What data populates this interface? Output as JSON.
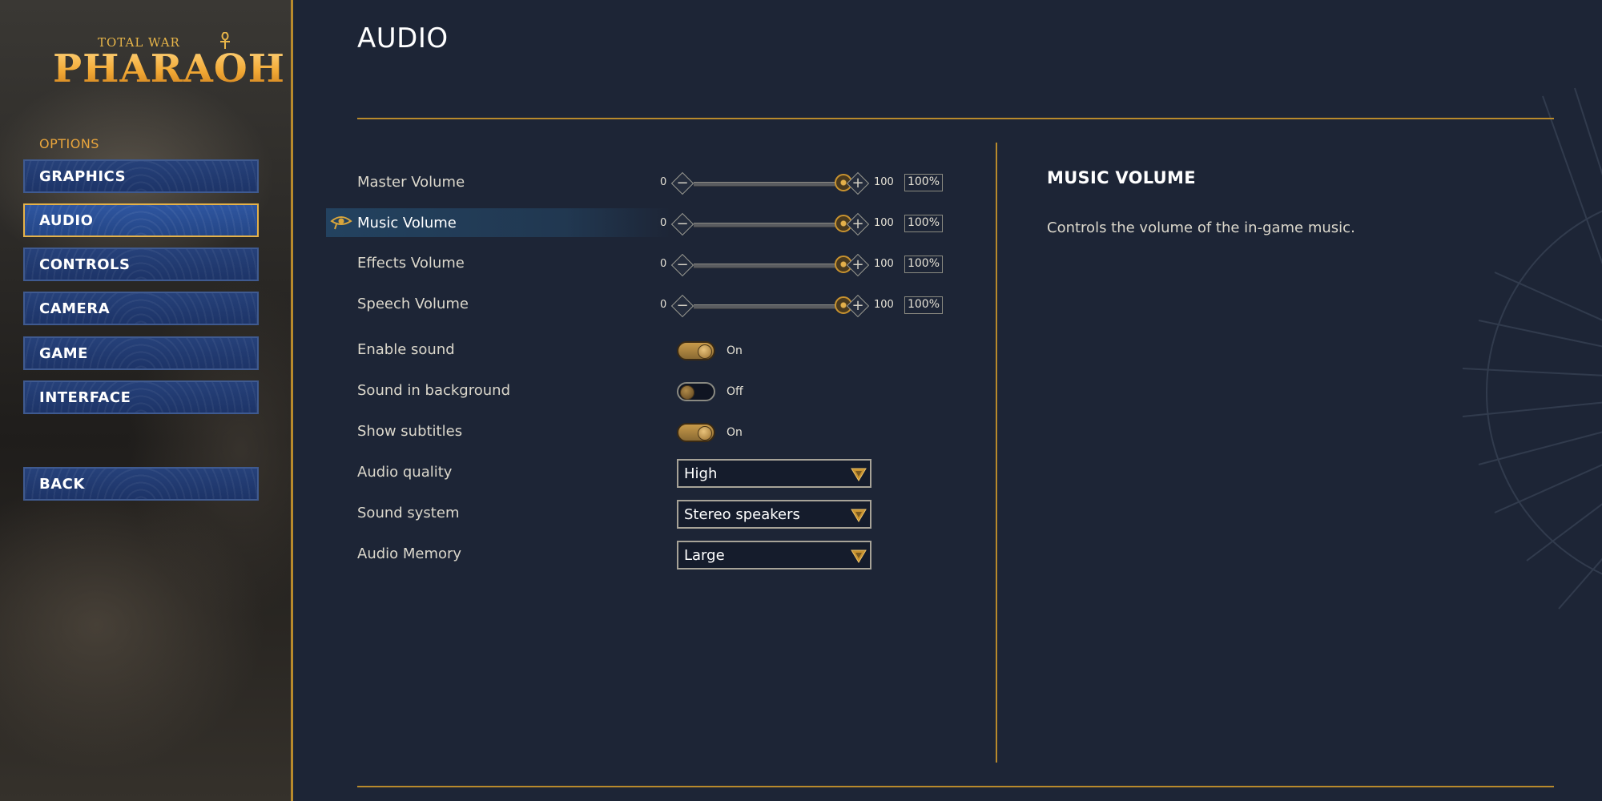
{
  "logo": {
    "subtitle": "TOTAL WAR",
    "title": "PHARAOH"
  },
  "sidebar": {
    "section_label": "OPTIONS",
    "items": [
      {
        "label": "GRAPHICS",
        "active": false
      },
      {
        "label": "AUDIO",
        "active": true
      },
      {
        "label": "CONTROLS",
        "active": false
      },
      {
        "label": "CAMERA",
        "active": false
      },
      {
        "label": "GAME",
        "active": false
      },
      {
        "label": "INTERFACE",
        "active": false
      }
    ],
    "back_label": "BACK"
  },
  "page": {
    "title": "AUDIO"
  },
  "volumes": [
    {
      "label": "Master Volume",
      "min": "0",
      "max": "100",
      "value": 100,
      "percent": "100%"
    },
    {
      "label": "Music Volume",
      "min": "0",
      "max": "100",
      "value": 100,
      "percent": "100%",
      "highlighted": true
    },
    {
      "label": "Effects Volume",
      "min": "0",
      "max": "100",
      "value": 100,
      "percent": "100%"
    },
    {
      "label": "Speech Volume",
      "min": "0",
      "max": "100",
      "value": 100,
      "percent": "100%"
    }
  ],
  "toggles": [
    {
      "label": "Enable sound",
      "state": "On",
      "on": true
    },
    {
      "label": "Sound in background",
      "state": "Off",
      "on": false
    },
    {
      "label": "Show subtitles",
      "state": "On",
      "on": true
    }
  ],
  "dropdowns": [
    {
      "label": "Audio quality",
      "value": "High"
    },
    {
      "label": "Sound system",
      "value": "Stereo speakers"
    },
    {
      "label": "Audio Memory",
      "value": "Large"
    }
  ],
  "info": {
    "title": "MUSIC VOLUME",
    "description": "Controls the volume of the in-game music."
  },
  "colors": {
    "accent_gold": "#b88a2c",
    "button_blue": "#26417a",
    "background": "#1d2536"
  }
}
